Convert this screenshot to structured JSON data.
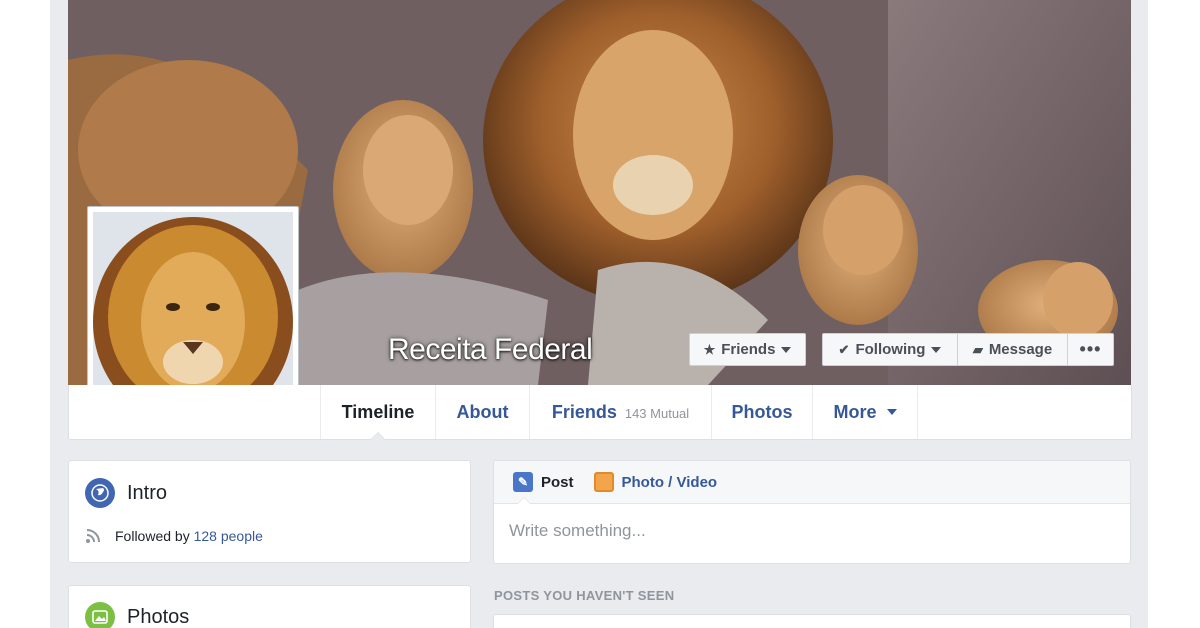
{
  "profile": {
    "name": "Receita Federal"
  },
  "cover_buttons": {
    "friends": "Friends",
    "following": "Following",
    "message": "Message",
    "more": "•••"
  },
  "nav": {
    "timeline": "Timeline",
    "about": "About",
    "friends": "Friends",
    "friends_mutual": "143 Mutual",
    "photos": "Photos",
    "more": "More"
  },
  "intro": {
    "title": "Intro",
    "followed_prefix": "Followed by",
    "followed_link": "128 people"
  },
  "photos_card": {
    "title": "Photos"
  },
  "composer": {
    "tab_post": "Post",
    "tab_photo": "Photo / Video",
    "placeholder": "Write something..."
  },
  "feed": {
    "section_label": "POSTS YOU HAVEN'T SEEN"
  },
  "colors": {
    "link": "#365899",
    "page_bg": "#e9ebee",
    "brand": "#4267b2"
  }
}
